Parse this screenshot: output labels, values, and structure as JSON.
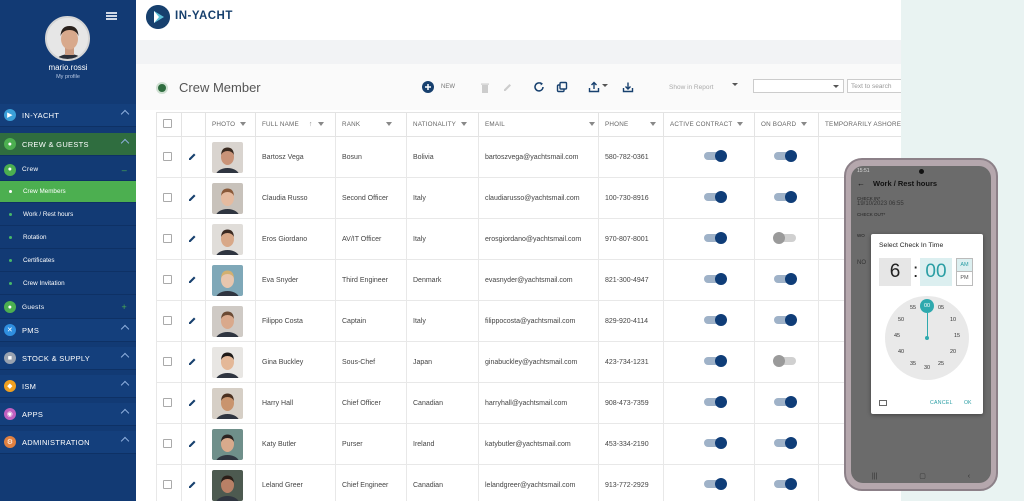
{
  "app": {
    "brand": "IN-YACHT"
  },
  "user": {
    "name": "mario.rossi",
    "profile_link": "My profile"
  },
  "sidebar": {
    "sections": [
      {
        "label": "IN-YACHT",
        "color": "#3a9fd8"
      },
      {
        "label": "CREW & GUESTS",
        "color": "#4caf50"
      },
      {
        "label": "PMS",
        "color": "#2f8fe0"
      },
      {
        "label": "STOCK & SUPPLY",
        "color": "#9aa3b0"
      },
      {
        "label": "ISM",
        "color": "#f0a020"
      },
      {
        "label": "APPS",
        "color": "#c060c0"
      },
      {
        "label": "ADMINISTRATION",
        "color": "#e08040"
      }
    ],
    "crew_label": "Crew",
    "crew_sub": [
      "Crew Members",
      "Work / Rest hours",
      "Rotation",
      "Certificates",
      "Crew Invitation"
    ],
    "guests_label": "Guests"
  },
  "toolbar": {
    "title": "Crew Member",
    "new_label": "NEW",
    "show_in_report": "Show in Report",
    "search_placeholder": "Text to search"
  },
  "table": {
    "headers": [
      "PHOTO",
      "FULL NAME",
      "RANK",
      "NATIONALITY",
      "EMAIL",
      "PHONE",
      "ACTIVE CONTRACT",
      "ON BOARD",
      "TEMPORARILY ASHORE"
    ],
    "rows": [
      {
        "name": "Bartosz Vega",
        "rank": "Bosun",
        "nationality": "Bolivia",
        "email": "bartoszvega@yachtsmail.com",
        "phone": "580-782-0361",
        "active": true,
        "onboard": true,
        "skin": "#c99378",
        "hair": "#3a2a20",
        "bg": "#d9d4cf"
      },
      {
        "name": "Claudia Russo",
        "rank": "Second Officer",
        "nationality": "Italy",
        "email": "claudiarusso@yachtsmail.com",
        "phone": "100-730-8916",
        "active": true,
        "onboard": true,
        "skin": "#e5bba0",
        "hair": "#8a5a3a",
        "bg": "#c8c2bb"
      },
      {
        "name": "Eros Giordano",
        "rank": "AV/IT Officer",
        "nationality": "Italy",
        "email": "erosgiordano@yachtsmail.com",
        "phone": "970-807-8001",
        "active": true,
        "onboard": false,
        "skin": "#d8a888",
        "hair": "#3b2a22",
        "bg": "#e0ddd9"
      },
      {
        "name": "Eva Snyder",
        "rank": "Third Engineer",
        "nationality": "Denmark",
        "email": "evasnyder@yachtsmail.com",
        "phone": "821-300-4947",
        "active": true,
        "onboard": true,
        "skin": "#e8c6ae",
        "hair": "#d2b070",
        "bg": "#7fa8b8"
      },
      {
        "name": "Filippo Costa",
        "rank": "Captain",
        "nationality": "Italy",
        "email": "filippocosta@yachtsmail.com",
        "phone": "829-920-4114",
        "active": true,
        "onboard": true,
        "skin": "#d9a98c",
        "hair": "#6a4a34",
        "bg": "#cfcac5"
      },
      {
        "name": "Gina Buckley",
        "rank": "Sous-Chef",
        "nationality": "Japan",
        "email": "ginabuckley@yachtsmail.com",
        "phone": "423-734-1231",
        "active": true,
        "onboard": false,
        "skin": "#e4b898",
        "hair": "#1e1a18",
        "bg": "#e8e6e3"
      },
      {
        "name": "Harry Hall",
        "rank": "Chief Officer",
        "nationality": "Canadian",
        "email": "harryhall@yachtsmail.com",
        "phone": "908-473-7359",
        "active": true,
        "onboard": true,
        "skin": "#c9946e",
        "hair": "#4a3020",
        "bg": "#d6cfc6"
      },
      {
        "name": "Katy Butler",
        "rank": "Purser",
        "nationality": "Ireland",
        "email": "katybutler@yachtsmail.com",
        "phone": "453-334-2190",
        "active": true,
        "onboard": true,
        "skin": "#d8aa8c",
        "hair": "#2a2220",
        "bg": "#6f8f8a"
      },
      {
        "name": "Leland Greer",
        "rank": "Chief Engineer",
        "nationality": "Canadian",
        "email": "lelandgreer@yachtsmail.com",
        "phone": "913-772-2929",
        "active": true,
        "onboard": true,
        "skin": "#b88066",
        "hair": "#2a1e18",
        "bg": "#4d5a50"
      }
    ]
  },
  "phone": {
    "status_time": "15:51",
    "screen_title": "Work / Rest hours",
    "check_in_label": "CHECK IN*",
    "check_in_value": "19/10/2023 06:55",
    "check_out_label": "CHECK OUT*",
    "work_label": "WO",
    "no_label": "NO",
    "dialog": {
      "title": "Select Check In Time",
      "hour": "6",
      "minute": "00",
      "am": "AM",
      "pm": "PM",
      "clock_numbers": [
        "00",
        "05",
        "10",
        "15",
        "20",
        "25",
        "30",
        "35",
        "40",
        "45",
        "50",
        "55"
      ],
      "cancel": "CANCEL",
      "ok": "OK"
    }
  }
}
